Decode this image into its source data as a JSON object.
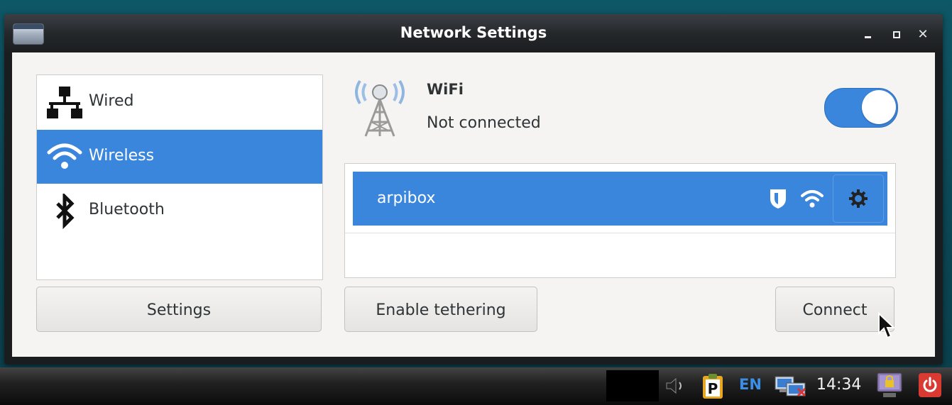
{
  "window": {
    "title": "Network Settings"
  },
  "sidebar": {
    "items": [
      {
        "label": "Wired",
        "icon": "wired-network-icon",
        "selected": false
      },
      {
        "label": "Wireless",
        "icon": "wifi-icon",
        "selected": true
      },
      {
        "label": "Bluetooth",
        "icon": "bluetooth-icon",
        "selected": false
      }
    ]
  },
  "wifi": {
    "heading": "WiFi",
    "status": "Not connected",
    "enabled": true
  },
  "networks": [
    {
      "ssid": "arpibox",
      "secured": true,
      "selected": true
    }
  ],
  "buttons": {
    "settings": "Settings",
    "tethering": "Enable tethering",
    "connect": "Connect"
  },
  "taskbar": {
    "language": "EN",
    "clock": "14:34"
  },
  "colors": {
    "accent": "#3b86dd",
    "window_bg": "#f5f4f3",
    "power": "#d93a32"
  }
}
